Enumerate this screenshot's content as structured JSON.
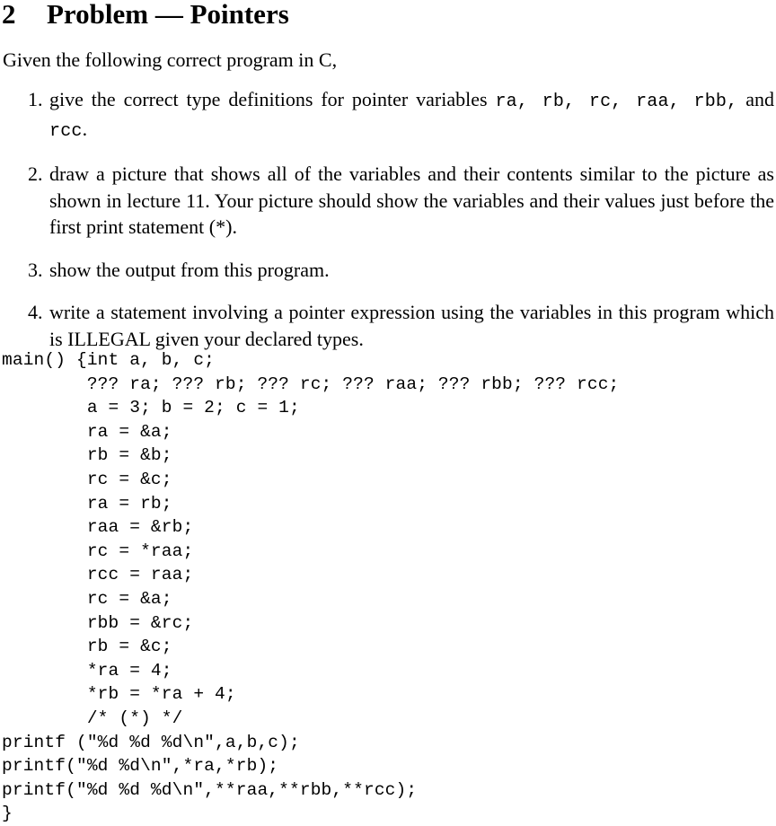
{
  "document": {
    "section_number": "2",
    "section_title": "Problem — Pointers",
    "intro": "Given the following correct program in C,",
    "questions": [
      {
        "marker": "1.",
        "text_before": "give the correct type definitions for pointer variables ",
        "code_vars": "ra, rb, rc, raa, rbb,",
        "text_middle": " and ",
        "code_vars_tail": "rcc",
        "text_after": "."
      },
      {
        "marker": "2.",
        "text": "draw a picture that shows all of the variables and their contents similar to the picture as shown in lecture 11. Your picture should show the variables and their values just before the first print statement (*)."
      },
      {
        "marker": "3.",
        "text": "show the output from this program."
      },
      {
        "marker": "4.",
        "text": "write a statement involving a pointer expression using the variables in this program which is ILLEGAL given your declared types."
      }
    ],
    "code_lines": [
      "main() {int a, b, c;",
      "        ??? ra; ??? rb; ??? rc; ??? raa; ??? rbb; ??? rcc;",
      "        a = 3; b = 2; c = 1;",
      "        ra = &a;",
      "        rb = &b;",
      "        rc = &c;",
      "        ra = rb;",
      "        raa = &rb;",
      "        rc = *raa;",
      "        rcc = raa;",
      "        rc = &a;",
      "        rbb = &rc;",
      "        rb = &c;",
      "        *ra = 4;",
      "        *rb = *ra + 4;",
      "        /* (*) */",
      "printf (\"%d %d %d\\n\",a,b,c);",
      "printf(\"%d %d\\n\",*ra,*rb);",
      "printf(\"%d %d %d\\n\",**raa,**rbb,**rcc);",
      "}"
    ]
  }
}
